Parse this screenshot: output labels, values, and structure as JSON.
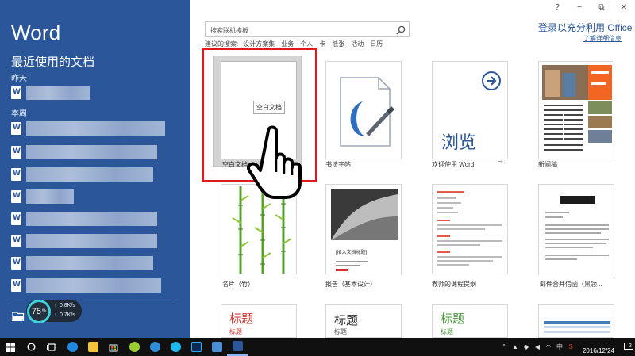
{
  "app": {
    "name": "Word"
  },
  "window": {
    "help": "?",
    "minimize": "−",
    "restore": "⧉",
    "close": "✕"
  },
  "left": {
    "recent_title": "最近使用的文档",
    "groups": [
      {
        "label": "昨天",
        "items": [
          "",
          ""
        ]
      },
      {
        "label": "本周",
        "items": [
          "",
          "",
          "",
          "",
          "",
          "",
          "",
          ""
        ]
      }
    ]
  },
  "search": {
    "placeholder": "搜索联机模板"
  },
  "suggested": {
    "label": "建议的搜索:",
    "items": [
      "设计方案集",
      "业务",
      "个人",
      "卡",
      "抵张",
      "活动",
      "日历"
    ]
  },
  "signin": {
    "text": "登录以充分利用 Office",
    "link": "了解详细信息"
  },
  "templates": [
    {
      "label": "空白文档",
      "tooltip": "空白文档"
    },
    {
      "label": "书法字帖"
    },
    {
      "label": "欢迎使用 Word",
      "tile_text": "浏览"
    },
    {
      "label": "新闻稿"
    },
    {
      "label": "名片（竹）"
    },
    {
      "label": "报告（基本设计）",
      "tile_text": "[插入文档标题]"
    },
    {
      "label": "教师的课程提纲"
    },
    {
      "label": "邮件合并信函（黑领..."
    },
    {
      "tile_title": "标题",
      "tile_sub": "标题"
    },
    {
      "tile_title": "标题",
      "tile_sub": "标题"
    },
    {
      "tile_title": "标题",
      "tile_sub": "标题"
    },
    {
      "tile_title": ""
    }
  ],
  "speed": {
    "percent": "75",
    "unit": "%",
    "up": "0.8K/s",
    "down": "0.7K/s"
  },
  "taskbar": {
    "date": "2016/12/24",
    "ime": "中",
    "notification_count": "2"
  },
  "colors": {
    "brand": "#2b579a",
    "highlight": "#e0191f",
    "taskbar": "#101010"
  }
}
